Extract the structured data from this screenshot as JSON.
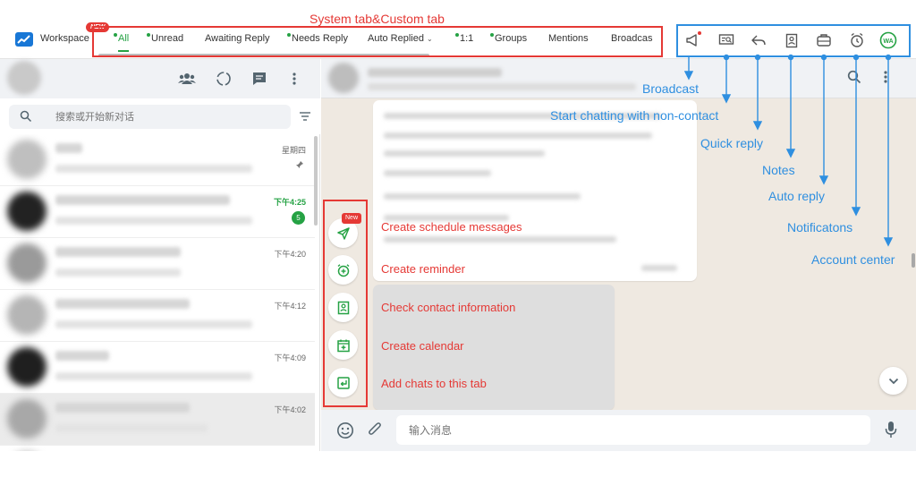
{
  "topbar": {
    "workspace_label": "Workspace",
    "new_badge": "NEW",
    "tabs": [
      {
        "label": "All",
        "active": true,
        "dot": true
      },
      {
        "label": "Unread",
        "active": false,
        "dot": true
      },
      {
        "label": "Awaiting Reply",
        "active": false,
        "dot": false
      },
      {
        "label": "Needs Reply",
        "active": false,
        "dot": true
      },
      {
        "label": "Auto Replied",
        "active": false,
        "dot": false
      },
      {
        "label": "1:1",
        "active": false,
        "dot": true
      },
      {
        "label": "Groups",
        "active": false,
        "dot": true
      },
      {
        "label": "Mentions",
        "active": false,
        "dot": false
      },
      {
        "label": "Broadcas",
        "active": false,
        "dot": false
      }
    ],
    "auto_replied_chevron": "⌄",
    "icons": [
      "broadcast-icon",
      "non-contact-chat-icon",
      "quick-reply-icon",
      "notes-icon",
      "auto-reply-icon",
      "notifications-icon",
      "account-center-icon"
    ]
  },
  "sidebar": {
    "system_tab_annotation": "System tab&Custom tab",
    "search_placeholder": "搜索或开始新对话",
    "chats": [
      {
        "time": "星期四",
        "pinned": true,
        "unread": null,
        "highlight": false,
        "selected": false
      },
      {
        "time": "下午4:25",
        "pinned": false,
        "unread": "5",
        "highlight": true,
        "selected": false
      },
      {
        "time": "下午4:20",
        "pinned": false,
        "unread": null,
        "highlight": false,
        "selected": false
      },
      {
        "time": "下午4:12",
        "pinned": false,
        "unread": null,
        "highlight": false,
        "selected": false
      },
      {
        "time": "下午4:09",
        "pinned": false,
        "unread": null,
        "highlight": false,
        "selected": false
      },
      {
        "time": "下午4:02",
        "pinned": false,
        "unread": null,
        "highlight": false,
        "selected": true
      }
    ]
  },
  "actions": {
    "new_tag": "New",
    "items": [
      {
        "label": "Create schedule messages",
        "icon": "send-schedule-icon"
      },
      {
        "label": "Create reminder",
        "icon": "alarm-add-icon"
      },
      {
        "label": "Check contact information",
        "icon": "contact-card-icon"
      },
      {
        "label": "Create calendar",
        "icon": "calendar-add-icon"
      },
      {
        "label": "Add chats to this tab",
        "icon": "add-to-tab-icon"
      }
    ]
  },
  "callouts": {
    "broadcast": "Broadcast",
    "non_contact": "Start chatting with non-contact",
    "quick_reply": "Quick reply",
    "notes": "Notes",
    "auto_reply": "Auto reply",
    "notifications": "Notificatons",
    "account_center": "Account center"
  },
  "compose": {
    "placeholder": "输入消息"
  },
  "colors": {
    "green": "#25a244",
    "annotation_red": "#e53935",
    "annotation_blue": "#2f8fe0"
  }
}
